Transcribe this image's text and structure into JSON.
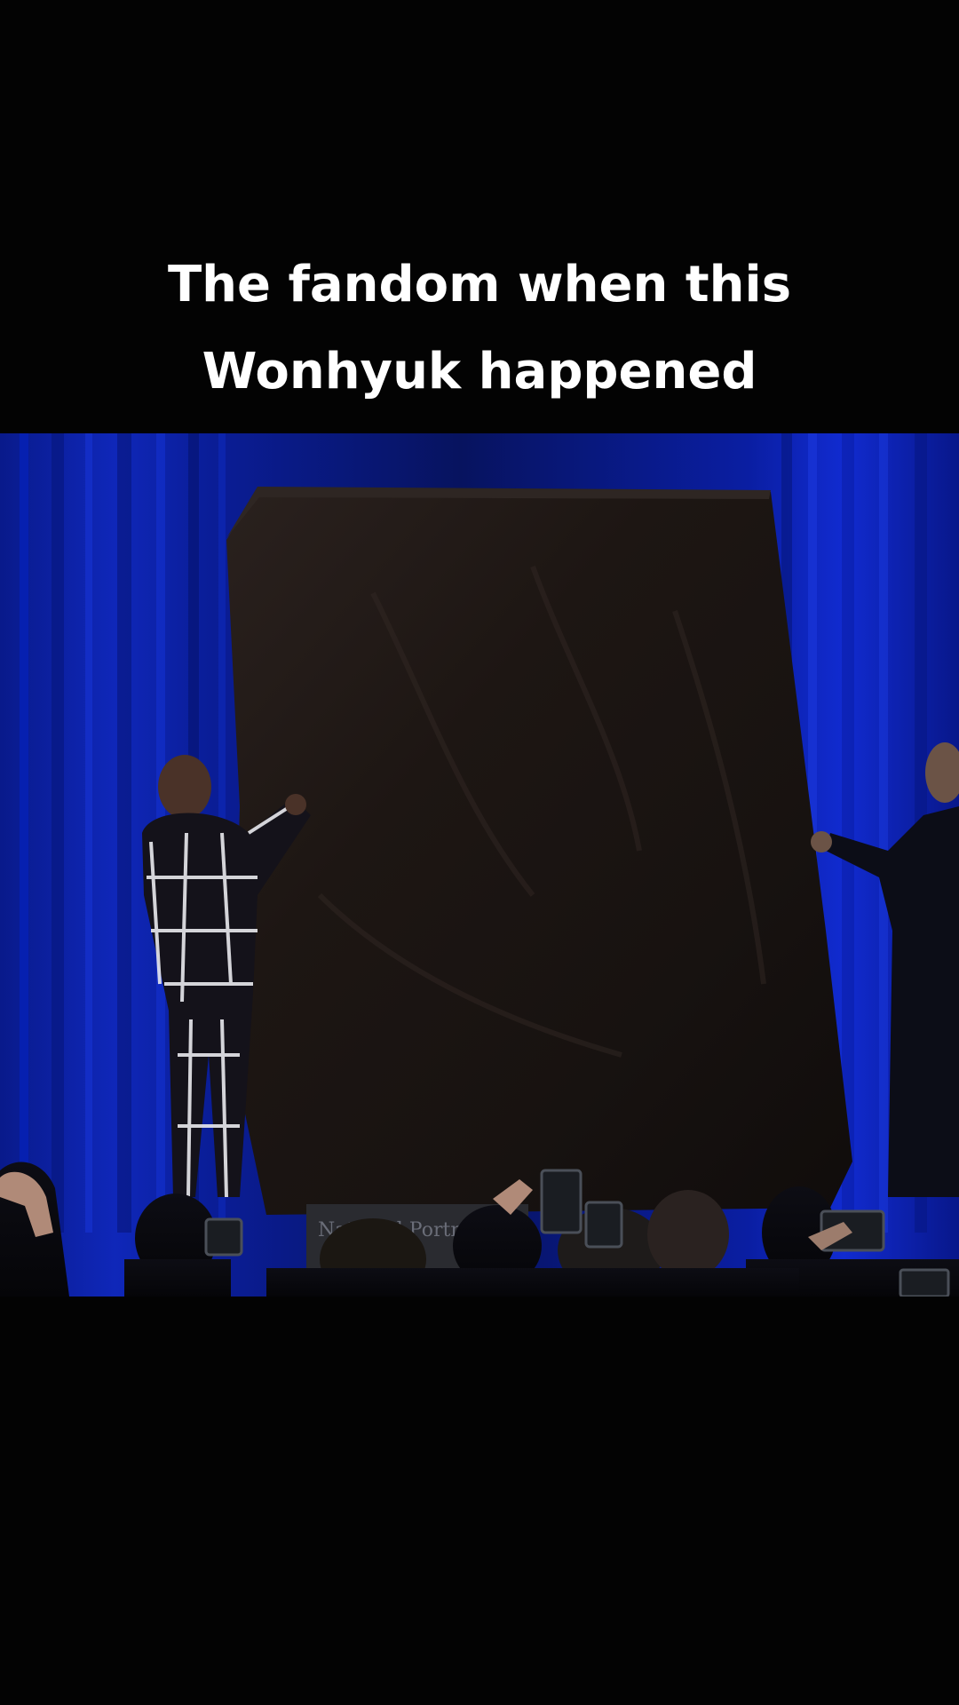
{
  "overlay": {
    "caption_lines": [
      "The fandom when this",
      "Wonhyuk happened"
    ]
  },
  "video": {
    "podium_sign_text": "National Portr",
    "scene": {
      "curtain_color": "#0b1f9a",
      "drape_color": "#1c1512",
      "background": "#030303"
    }
  }
}
